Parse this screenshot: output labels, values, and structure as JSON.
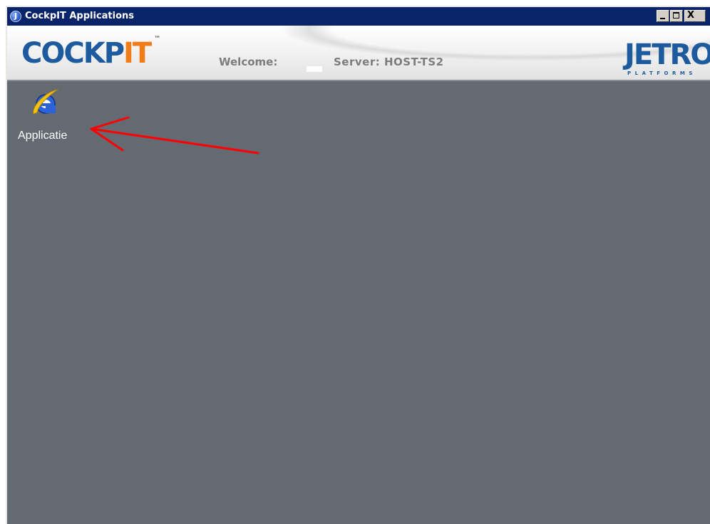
{
  "window": {
    "title": "CockpIT Applications",
    "app_icon_letter": "J",
    "controls": {
      "minimize": "minimize-icon",
      "maximize": "maximize-icon",
      "close_glyph": "X"
    }
  },
  "header": {
    "logo": {
      "part1": "COCKP",
      "part2": "IT",
      "trademark": "™"
    },
    "welcome_label": "Welcome:",
    "server_label": "Server: HOST-TS2",
    "brand": {
      "name": "JETRO",
      "subtitle": "PLATFORMS"
    }
  },
  "desktop": {
    "shortcuts": [
      {
        "label": "Applicatie",
        "icon": "internet-explorer-icon"
      }
    ]
  },
  "colors": {
    "titlebar": "#0a246a",
    "desktop_bg": "#646a72",
    "logo_blue": "#1e5a9e",
    "logo_orange": "#f07c1a",
    "header_text": "#7d7d7d",
    "annotation_arrow": "#ff0000"
  }
}
